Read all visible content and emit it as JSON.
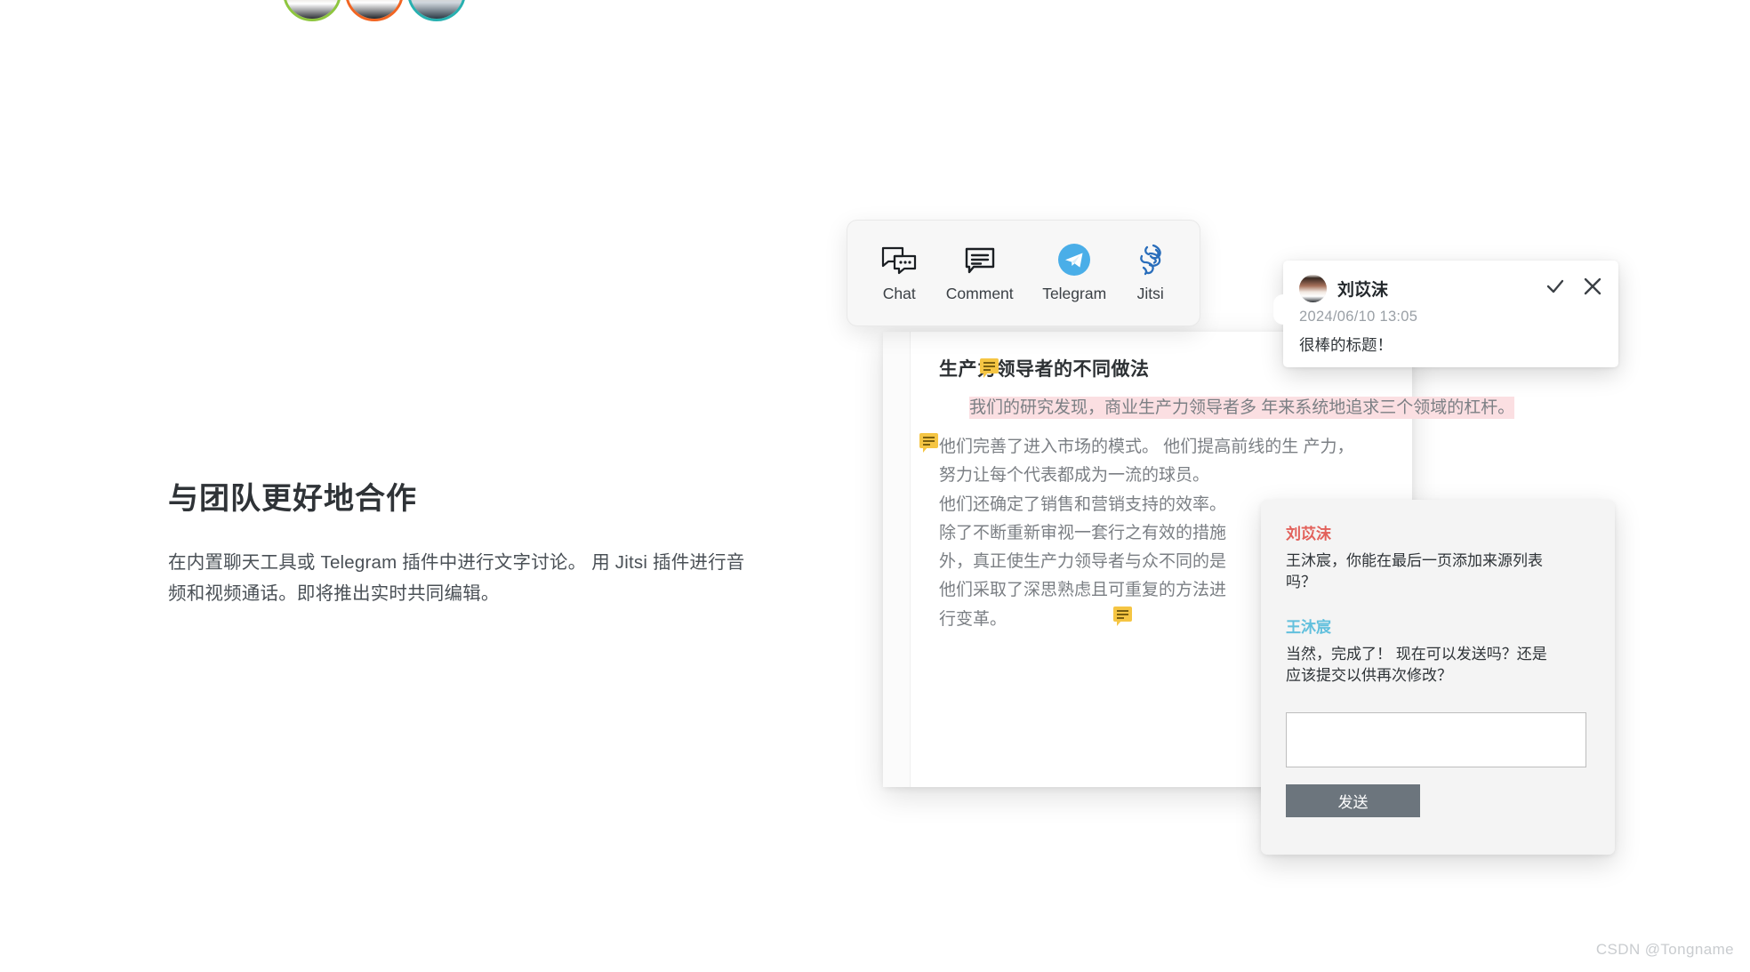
{
  "page": {
    "background": "#ffffff",
    "watermark": "CSDN @Tongname"
  },
  "avatars": {
    "ring_colors": [
      "#8ec63f",
      "#f26522",
      "#27b0b0"
    ],
    "count": 3
  },
  "copy": {
    "title": "与团队更好地合作",
    "body": "在内置聊天工具或 Telegram 插件中进行文字讨论。 用 Jitsi 插件进行音频和视频通话。即将推出实时共同编辑。"
  },
  "toolbar": {
    "items": [
      {
        "label": "Chat",
        "icon": "chat-bubbles-icon"
      },
      {
        "label": "Comment",
        "icon": "comment-bubble-icon"
      },
      {
        "label": "Telegram",
        "icon": "telegram-icon",
        "color": "#4aaee8"
      },
      {
        "label": "Jitsi",
        "icon": "jitsi-icon",
        "color": "#2a6ebb"
      }
    ]
  },
  "document": {
    "heading": "生产力领导者的不同做法",
    "highlight_color": "#fbdfe2",
    "highlighted_paragraph": "我们的研究发现，商业生产力领导者多 年来系统地追求三个领域的杠杆。",
    "paragraph_lines": [
      "他们完善了进入市场的模式。 他们提高前线的生 产力，",
      "努力让每个代表都成为一流的球员。",
      "他们还确定了销售和营销支持的效率。",
      "除了不断重新审视一套行之有效的措施",
      "外，真正使生产力领导者与众不同的是",
      "他们采取了深思熟虑且可重复的方法进",
      "行变革。"
    ],
    "comment_pins": 3
  },
  "comment_popup": {
    "author": "刘苡沫",
    "timestamp": "2024/06/10 13:05",
    "text": "很棒的标题！",
    "resolve_icon": "check-icon",
    "close_icon": "close-icon"
  },
  "chat_panel": {
    "messages": [
      {
        "name": "刘苡沫",
        "name_color": "#e2605a",
        "text": "王沐宸，你能在最后一页添加来源列表吗？"
      },
      {
        "name": "王沐宸",
        "name_color": "#62c0dd",
        "text": "当然，完成了！ 现在可以发送吗？还是应该提交以供再次修改？"
      }
    ],
    "input_value": "",
    "input_placeholder": "",
    "send_label": "发送",
    "send_color": "#6c757d"
  }
}
